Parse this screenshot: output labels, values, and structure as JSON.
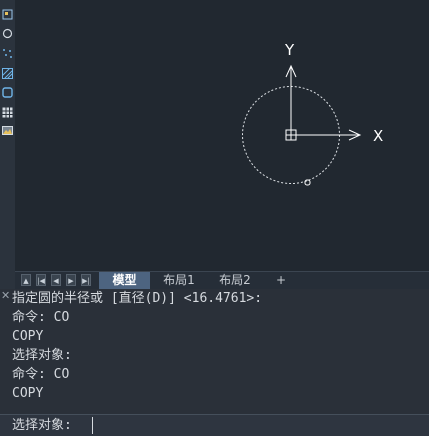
{
  "toolbar": {
    "icons": [
      "block-icon",
      "circle-icon",
      "point-icon",
      "hatch-icon",
      "region-icon",
      "table-icon",
      "image-icon"
    ]
  },
  "canvas": {
    "ucs_x_label": "X",
    "ucs_y_label": "Y"
  },
  "layout_tabs": {
    "nav_buttons": [
      "▲",
      "|◀",
      "◀",
      "▶",
      "▶|"
    ],
    "tabs": [
      {
        "label": "模型",
        "active": true
      },
      {
        "label": "布局1",
        "active": false
      },
      {
        "label": "布局2",
        "active": false
      },
      {
        "label": "+",
        "active": false
      }
    ]
  },
  "command": {
    "close_glyph": "✕",
    "history": [
      "指定圆的半径或 [直径(D)] <16.4761>:",
      "命令: CO",
      "COPY",
      "选择对象:",
      "命令: CO",
      "COPY"
    ],
    "prompt_label": "选择对象:",
    "input_value": ""
  },
  "colors": {
    "canvas_bg": "#212830",
    "active_tab": "#4d6480",
    "drawing_lines": "#ffffff"
  }
}
